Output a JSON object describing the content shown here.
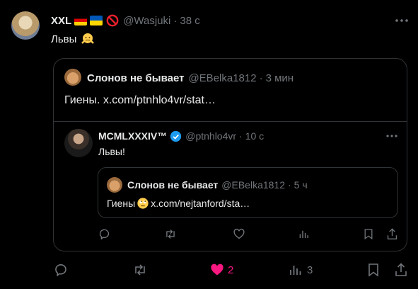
{
  "outer_tweet": {
    "display_name": "XXL",
    "handle": "@Wasjuki",
    "separator": "·",
    "time": "38 с",
    "text": "Львы",
    "actions": {
      "like_count": "2",
      "views_count": "3"
    }
  },
  "quoted_tweet": {
    "display_name": "Слонов не бывает",
    "handle": "@EBelka1812",
    "separator": "·",
    "time": "3 мин",
    "text": "Гиены.  x.com/ptnhlo4vr/stat…"
  },
  "nested_tweet": {
    "display_name": "MCMLXXXIV™",
    "handle": "@ptnhlo4vr",
    "separator": "·",
    "time": "10 с",
    "text": "Львы!"
  },
  "nested_quote": {
    "display_name": "Слонов не бывает",
    "handle": "@EBelka1812",
    "separator": "·",
    "time": "5 ч",
    "text_before": "Гиены",
    "text_after": " x.com/nejtanford/sta…"
  },
  "colors": {
    "background": "#000000",
    "text": "#e7e9ea",
    "muted": "#71767b",
    "border": "#2f3336",
    "like": "#f91880",
    "verified": "#1d9bf0"
  }
}
